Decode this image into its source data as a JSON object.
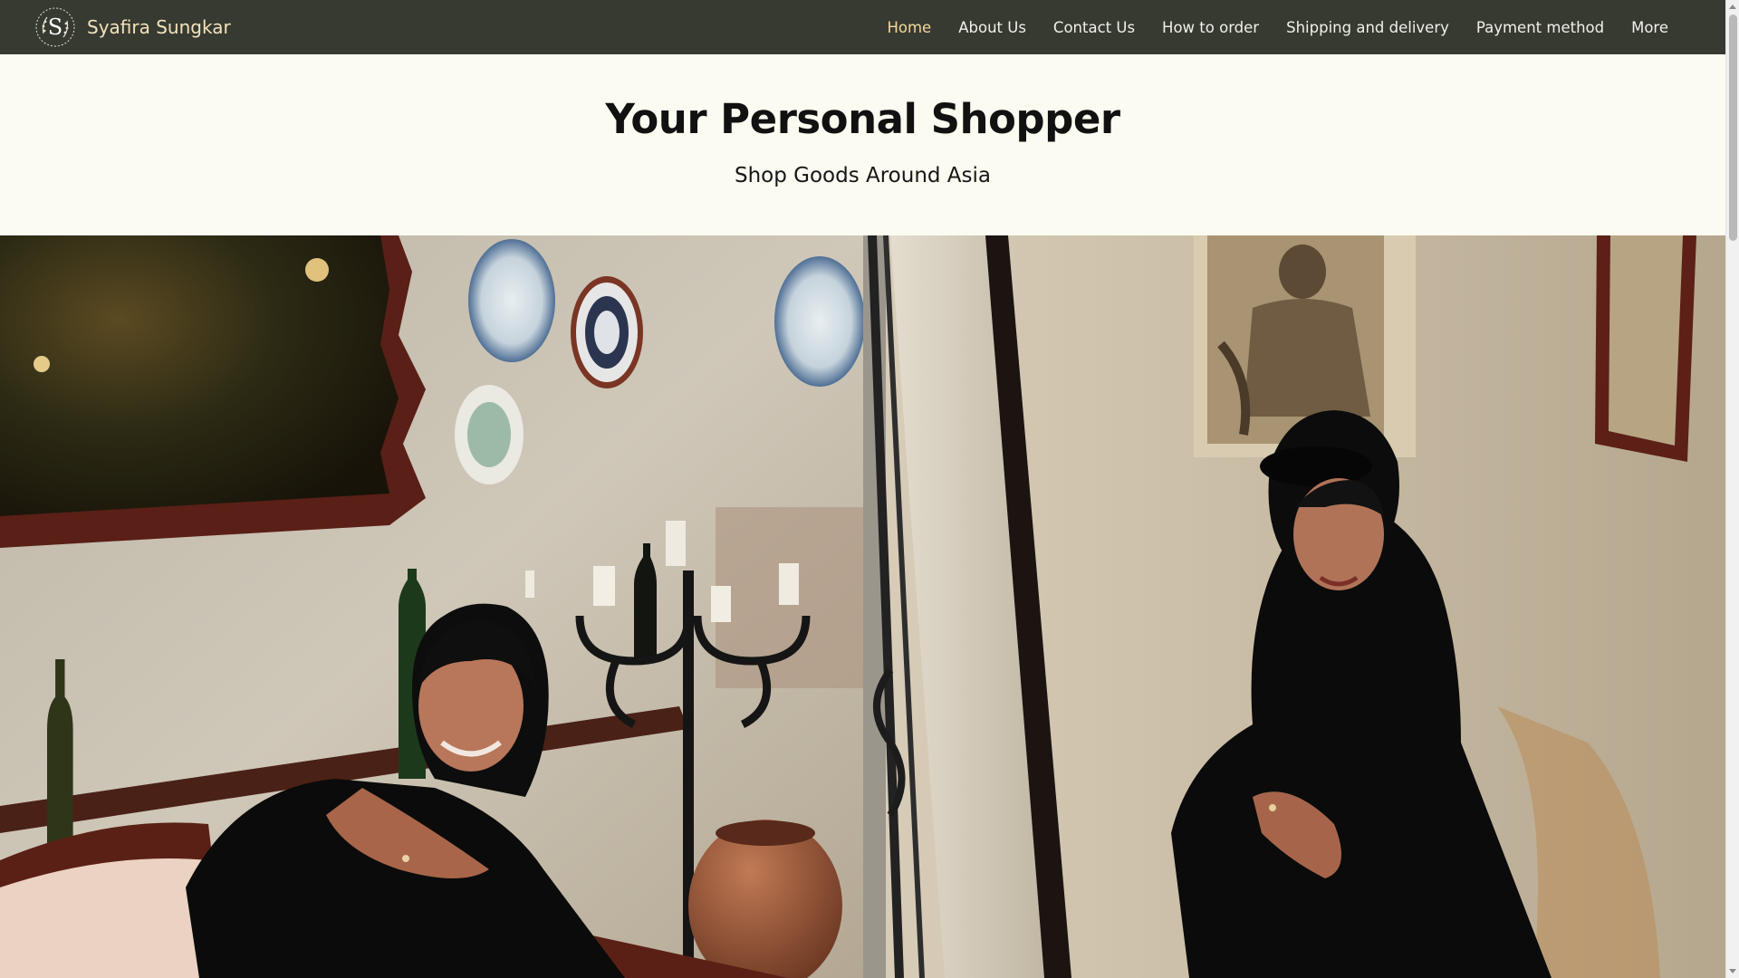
{
  "header": {
    "brand_name": "Syafira Sungkar",
    "logo_icon": "monogram-s-logo-icon",
    "nav_items": [
      {
        "label": "Home",
        "active": true
      },
      {
        "label": "About Us",
        "active": false
      },
      {
        "label": "Contact Us",
        "active": false
      },
      {
        "label": "How to order",
        "active": false
      },
      {
        "label": "Shipping and delivery",
        "active": false
      },
      {
        "label": "Payment method",
        "active": false
      },
      {
        "label": "More",
        "active": false
      }
    ]
  },
  "hero": {
    "title": "Your Personal Shopper",
    "subtitle": "Shop Goods Around Asia"
  },
  "colors": {
    "header_bg": "#373a31",
    "brand_text": "#f2e3bd",
    "nav_active": "#f3d99b",
    "page_bg": "#fbfbf1"
  }
}
